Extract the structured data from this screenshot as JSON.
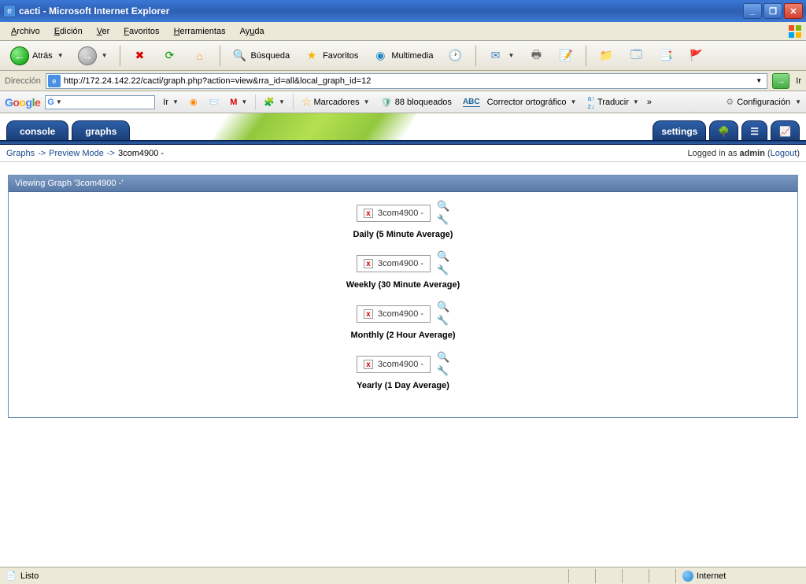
{
  "window": {
    "title": "cacti - Microsoft Internet Explorer"
  },
  "menubar": {
    "items": [
      "Archivo",
      "Edición",
      "Ver",
      "Favoritos",
      "Herramientas",
      "Ayuda"
    ]
  },
  "toolbar": {
    "back": "Atrás",
    "search": "Búsqueda",
    "favorites": "Favoritos",
    "multimedia": "Multimedia"
  },
  "address": {
    "label": "Dirección",
    "url": "http://172.24.142.22/cacti/graph.php?action=view&rra_id=all&local_graph_id=12",
    "go": "Ir"
  },
  "google": {
    "logo": "Google",
    "ir": "Ir",
    "bookmarks": "Marcadores",
    "popups_blocked": "88 bloqueados",
    "spellcheck": "Corrector ortográfico",
    "translate": "Traducir",
    "translate_prefix": "a ↑ z ↓",
    "config": "Configuración"
  },
  "cacti": {
    "tabs": {
      "console": "console",
      "graphs": "graphs"
    },
    "settings": "settings",
    "breadcrumb": {
      "graphs": "Graphs",
      "preview": "Preview Mode",
      "item": "3com4900 -"
    },
    "login": {
      "prefix": "Logged in as",
      "user": "admin",
      "logout": "Logout"
    },
    "panel_title_prefix": "Viewing Graph",
    "panel_title_name": "'3com4900 -'",
    "graphs": [
      {
        "name": "3com4900 -",
        "caption": "Daily (5 Minute Average)"
      },
      {
        "name": "3com4900 -",
        "caption": "Weekly (30 Minute Average)"
      },
      {
        "name": "3com4900 -",
        "caption": "Monthly (2 Hour Average)"
      },
      {
        "name": "3com4900 -",
        "caption": "Yearly (1 Day Average)"
      }
    ]
  },
  "status": {
    "ready": "Listo",
    "zone": "Internet"
  }
}
